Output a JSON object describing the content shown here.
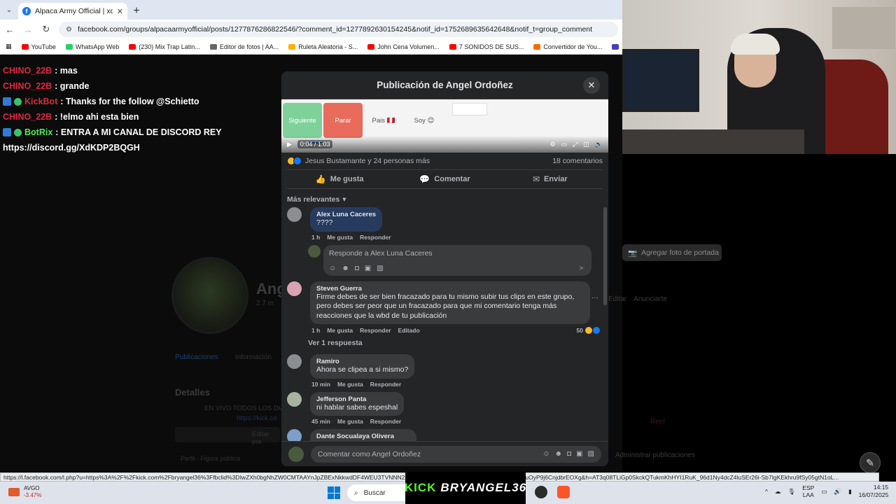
{
  "browser": {
    "tab_title": "Alpaca Army Official | xddddd",
    "url": "facebook.com/groups/alpacaarmyofficial/posts/1277876286822546/?comment_id=1277892630154245&notif_id=1752689635642648&notif_t=group_comment",
    "bookmarks": [
      {
        "label": "YouTube",
        "color": "#ff0000"
      },
      {
        "label": "WhatsApp Web",
        "color": "#25d366"
      },
      {
        "label": "(230) Mix Trap Latin...",
        "color": "#ff0000"
      },
      {
        "label": "Editor de fotos | AA...",
        "color": "#666666"
      },
      {
        "label": "Ruleta Aleatoria - S...",
        "color": "#ffb000"
      },
      {
        "label": "John Cena Volumen...",
        "color": "#ff0000"
      },
      {
        "label": "7 SONIDOS DE SUS...",
        "color": "#ff0000"
      },
      {
        "label": "Convertidor de You...",
        "color": "#ff6a00"
      },
      {
        "label": "Eliminador de Voz y...",
        "color": "#4a3fb5"
      }
    ]
  },
  "chat": [
    {
      "user": "CHINO_22B",
      "msg": ": mas",
      "color": "#e0263f",
      "badges": []
    },
    {
      "user": "CHINO_22B",
      "msg": ": grande",
      "color": "#e0263f",
      "badges": []
    },
    {
      "user": "KickBot",
      "msg": ": Thanks for the follow @Schietto",
      "color": "#d22f3a",
      "badges": [
        "bot",
        "ok"
      ]
    },
    {
      "user": "CHINO_22B",
      "msg": ": !elmo ahi esta bien",
      "color": "#e0263f",
      "badges": []
    },
    {
      "user": "BotRix",
      "msg": ": ENTRA A MI CANAL DE DISCORD REY",
      "color": "#55ea57",
      "badges": [
        "bot",
        "ok"
      ]
    },
    {
      "user": "",
      "msg": "https://discord.gg/XdKDP2BQGH",
      "color": "#ffffff",
      "badges": []
    }
  ],
  "background": {
    "name": "Ang",
    "sub": "2.7 m",
    "tabs": [
      "Publicaciones",
      "Información"
    ],
    "details_title": "Detalles",
    "details_text": "EN VIVO TODOS LOS DIA",
    "details_link": "https://kick.co",
    "edit_label": "Editar pre",
    "perfil": "Perfil · Figura pública",
    "cover_btn": "Agregar foto de portada",
    "edit": "Editar",
    "announce": "Anunciarte",
    "reel": "Reel",
    "admin_pubs": "Administrar publicaciones"
  },
  "modal": {
    "title": "Publicación de Angel Ordoñez",
    "video": {
      "buttons": [
        "Siguiente",
        "Parar",
        "Pais 🇵🇪",
        "Soy 😊"
      ],
      "time": "0:04 / 1:03",
      "progress": 0.063
    },
    "reactions_text": "Jesus Bustamante y 24 personas más",
    "comments_count": "18 comentarios",
    "actions": {
      "like": "Me gusta",
      "comment": "Comentar",
      "share": "Enviar"
    },
    "sort_label": "Más relevantes",
    "comments": [
      {
        "name": "Alex Luna Caceres",
        "text": "????",
        "time": "1 h",
        "like": "Me gusta",
        "reply": "Responder",
        "edited": "",
        "count": ""
      },
      {
        "name": "Steven Guerra",
        "text": "Firme debes de ser bien fracazado para tu mismo subir tus clips en este grupo, pero debes ser peor que un fracazado para que mi comentario tenga más reacciones que la wbd de tu publicación",
        "time": "1 h",
        "like": "Me gusta",
        "reply": "Responder",
        "edited": "Editado",
        "count": "50"
      },
      {
        "name": "Ramiro",
        "text": "Ahora se clipea a si mismo?",
        "time": "10 min",
        "like": "Me gusta",
        "reply": "Responder",
        "edited": "",
        "count": ""
      },
      {
        "name": "Jefferson Panta",
        "text": "ni hablar sabes espeshal",
        "time": "45 min",
        "like": "Me gusta",
        "reply": "Responder",
        "edited": "",
        "count": ""
      },
      {
        "name": "Dante Socualaya Olivera",
        "text": "──────────────────",
        "time": "",
        "like": "",
        "reply": "",
        "edited": "",
        "count": ""
      }
    ],
    "reply_placeholder": "Responde a Alex Luna Caceres",
    "view_replies": "Ver 1 respuesta",
    "composer_placeholder": "Comentar como Angel Ordoñez"
  },
  "status_url": "https://l.facebook.com/l.php?u=https%3A%2F%2Fkick.com%2Fbryangel36%3Ffbclid%3DIwZXh0bgNhZW0CMTAAYnJpZBExNkkwdDF4WEU3TVNNN2Z0MwEeisagZ...aNrJofvz-NdwA_aem_OkAacuOyP9j6CnjdbrEOXg&h=AT3q08TLiGp0SkckQTukmKhHYI1RuK_96d1Ny4dcZ4luSEr26i-Sb7IgKEkhru9fSy05gtN1oL...",
  "taskbar": {
    "stock_name": "AVGO",
    "stock_change": "-3.47%",
    "search_label": "Buscar",
    "kick_logo": "KICK",
    "kick_channel": "BRYANGEL36",
    "lang_top": "ESP",
    "lang_bottom": "LAA",
    "time": "14:15",
    "date": "16/07/2025"
  }
}
